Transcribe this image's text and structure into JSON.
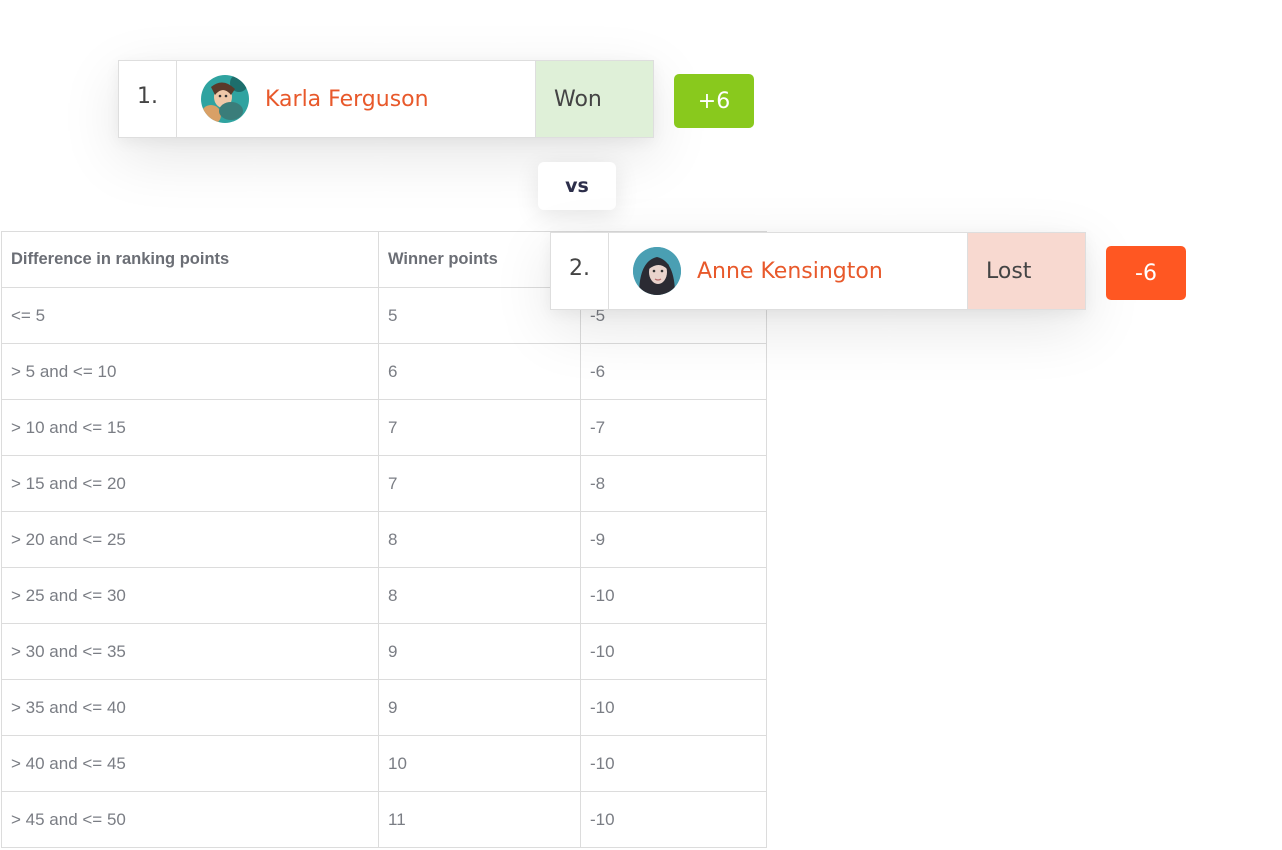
{
  "match": {
    "player1": {
      "rank": "1.",
      "name": "Karla Ferguson",
      "result": "Won",
      "points": "+6",
      "avatar_icon": "avatar-karla-ferguson"
    },
    "vs_label": "vs",
    "player2": {
      "rank": "2.",
      "name": "Anne Kensington",
      "result": "Lost",
      "points": "-6",
      "avatar_icon": "avatar-anne-kensington"
    }
  },
  "colors": {
    "name_accent": "#e8592b",
    "won_bg": "#dff0d8",
    "lost_bg": "#f8d9d0",
    "plus_badge": "#89c91d",
    "minus_badge": "#ff5722"
  },
  "table": {
    "headers": [
      "Difference in ranking points",
      "Winner points",
      ""
    ],
    "rows": [
      [
        "<= 5",
        "5",
        "-5"
      ],
      [
        "> 5 and <= 10",
        "6",
        "-6"
      ],
      [
        "> 10 and <= 15",
        "7",
        "-7"
      ],
      [
        "> 15 and <= 20",
        "7",
        "-8"
      ],
      [
        "> 20 and <= 25",
        "8",
        "-9"
      ],
      [
        "> 25 and <= 30",
        "8",
        "-10"
      ],
      [
        "> 30 and <= 35",
        "9",
        "-10"
      ],
      [
        "> 35 and <= 40",
        "9",
        "-10"
      ],
      [
        "> 40 and <= 45",
        "10",
        "-10"
      ],
      [
        "> 45 and <= 50",
        "11",
        "-10"
      ]
    ]
  }
}
